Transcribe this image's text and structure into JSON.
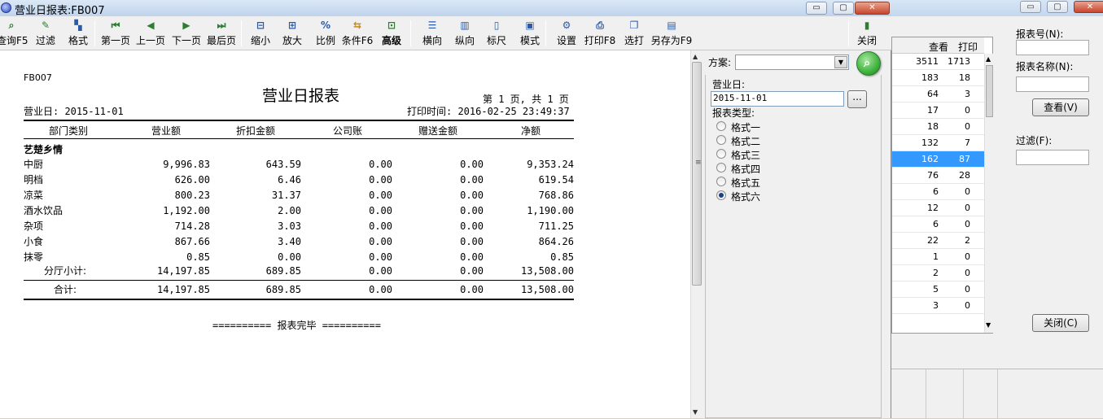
{
  "bg_window": {
    "title_buttons": [
      "▭",
      "▢",
      "✕"
    ],
    "table_header": {
      "view": "查看",
      "print": "打印"
    },
    "rows": [
      {
        "view": "3511",
        "print": "1713"
      },
      {
        "view": "183",
        "print": "18"
      },
      {
        "view": "64",
        "print": "3"
      },
      {
        "view": "17",
        "print": "0"
      },
      {
        "view": "18",
        "print": "0"
      },
      {
        "view": "132",
        "print": "7"
      },
      {
        "view": "162",
        "print": "87"
      },
      {
        "view": "76",
        "print": "28"
      },
      {
        "view": "6",
        "print": "0"
      },
      {
        "view": "12",
        "print": "0"
      },
      {
        "view": "6",
        "print": "0"
      },
      {
        "view": "22",
        "print": "2"
      },
      {
        "view": "1",
        "print": "0"
      },
      {
        "view": "2",
        "print": "0"
      },
      {
        "view": "5",
        "print": "0"
      },
      {
        "view": "3",
        "print": "0"
      }
    ],
    "selected_row": 6,
    "report_no_label": "报表号(N):",
    "report_name_label": "报表名称(N):",
    "view_button": "查看(V)",
    "filter_label": "过滤(F):",
    "close_button": "关闭(C)"
  },
  "window": {
    "title": "营业日报表:FB007",
    "buttons": [
      "▭",
      "▢",
      "✕"
    ]
  },
  "toolbar": [
    {
      "icon": "query-icon",
      "glyph": "⌕",
      "label": "查询F5"
    },
    {
      "icon": "filter-icon",
      "glyph": "✎",
      "label": "过滤"
    },
    {
      "icon": "format-icon",
      "glyph": "▚",
      "label": "格式"
    },
    {
      "icon": "first-page-icon",
      "glyph": "⏮",
      "label": "第一页"
    },
    {
      "icon": "prev-page-icon",
      "glyph": "◀",
      "label": "上一页"
    },
    {
      "icon": "next-page-icon",
      "glyph": "▶",
      "label": "下一页"
    },
    {
      "icon": "last-page-icon",
      "glyph": "⏭",
      "label": "最后页"
    },
    {
      "icon": "zoom-out-icon",
      "glyph": "⊟",
      "label": "缩小"
    },
    {
      "icon": "zoom-in-icon",
      "glyph": "⊞",
      "label": "放大"
    },
    {
      "icon": "ratio-icon",
      "glyph": "%",
      "label": "比例"
    },
    {
      "icon": "condition-icon",
      "glyph": "⇆",
      "label": "条件F6"
    },
    {
      "icon": "advanced-icon",
      "glyph": "⊡",
      "label": "高级"
    },
    {
      "icon": "landscape-icon",
      "glyph": "☰",
      "label": "横向"
    },
    {
      "icon": "portrait-icon",
      "glyph": "▥",
      "label": "纵向"
    },
    {
      "icon": "ruler-icon",
      "glyph": "▯",
      "label": "标尺"
    },
    {
      "icon": "mode-icon",
      "glyph": "▣",
      "label": "模式"
    },
    {
      "icon": "settings-icon",
      "glyph": "⚙",
      "label": "设置"
    },
    {
      "icon": "print-icon",
      "glyph": "⎙",
      "label": "打印F8"
    },
    {
      "icon": "select-print-icon",
      "glyph": "❐",
      "label": "选打"
    },
    {
      "icon": "save-as-icon",
      "glyph": "▤",
      "label": "另存为F9"
    },
    {
      "icon": "close-icon",
      "glyph": "▮",
      "label": "关闭"
    }
  ],
  "report": {
    "code": "FB007",
    "title": "营业日报表",
    "page_info": "第 1 页, 共 1 页",
    "business_day": "营业日: 2015-11-01",
    "print_time": "打印时间: 2016-02-25 23:49:37",
    "headers": [
      "部门类别",
      "营业额",
      "折扣金额",
      "公司账",
      "赠送金额",
      "净额"
    ],
    "group": "艺楚乡情",
    "rows": [
      {
        "dept": "中厨",
        "sales": "9,996.83",
        "discount": "643.59",
        "company": "0.00",
        "gift": "0.00",
        "net": "9,353.24"
      },
      {
        "dept": "明档",
        "sales": "626.00",
        "discount": "6.46",
        "company": "0.00",
        "gift": "0.00",
        "net": "619.54"
      },
      {
        "dept": "凉菜",
        "sales": "800.23",
        "discount": "31.37",
        "company": "0.00",
        "gift": "0.00",
        "net": "768.86"
      },
      {
        "dept": "酒水饮品",
        "sales": "1,192.00",
        "discount": "2.00",
        "company": "0.00",
        "gift": "0.00",
        "net": "1,190.00"
      },
      {
        "dept": "杂项",
        "sales": "714.28",
        "discount": "3.03",
        "company": "0.00",
        "gift": "0.00",
        "net": "711.25"
      },
      {
        "dept": "小食",
        "sales": "867.66",
        "discount": "3.40",
        "company": "0.00",
        "gift": "0.00",
        "net": "864.26"
      },
      {
        "dept": "抹零",
        "sales": "0.85",
        "discount": "0.00",
        "company": "0.00",
        "gift": "0.00",
        "net": "0.85"
      }
    ],
    "subtotal": {
      "label": "分厅小计:",
      "sales": "14,197.85",
      "discount": "689.85",
      "company": "0.00",
      "gift": "0.00",
      "net": "13,508.00"
    },
    "total": {
      "label": "合计:",
      "sales": "14,197.85",
      "discount": "689.85",
      "company": "0.00",
      "gift": "0.00",
      "net": "13,508.00"
    },
    "footer": "========== 报表完毕 =========="
  },
  "right_panel": {
    "scheme_label": "方案:",
    "scheme_value": "",
    "business_day_label": "营业日:",
    "business_day_value": "2015-11-01",
    "browse_button": "...",
    "report_type_label": "报表类型:",
    "types": [
      "格式一",
      "格式二",
      "格式三",
      "格式四",
      "格式五",
      "格式六"
    ],
    "selected_type": 5
  },
  "colors": {
    "accent": "#3399ff",
    "search_button": "#3fb33f"
  }
}
